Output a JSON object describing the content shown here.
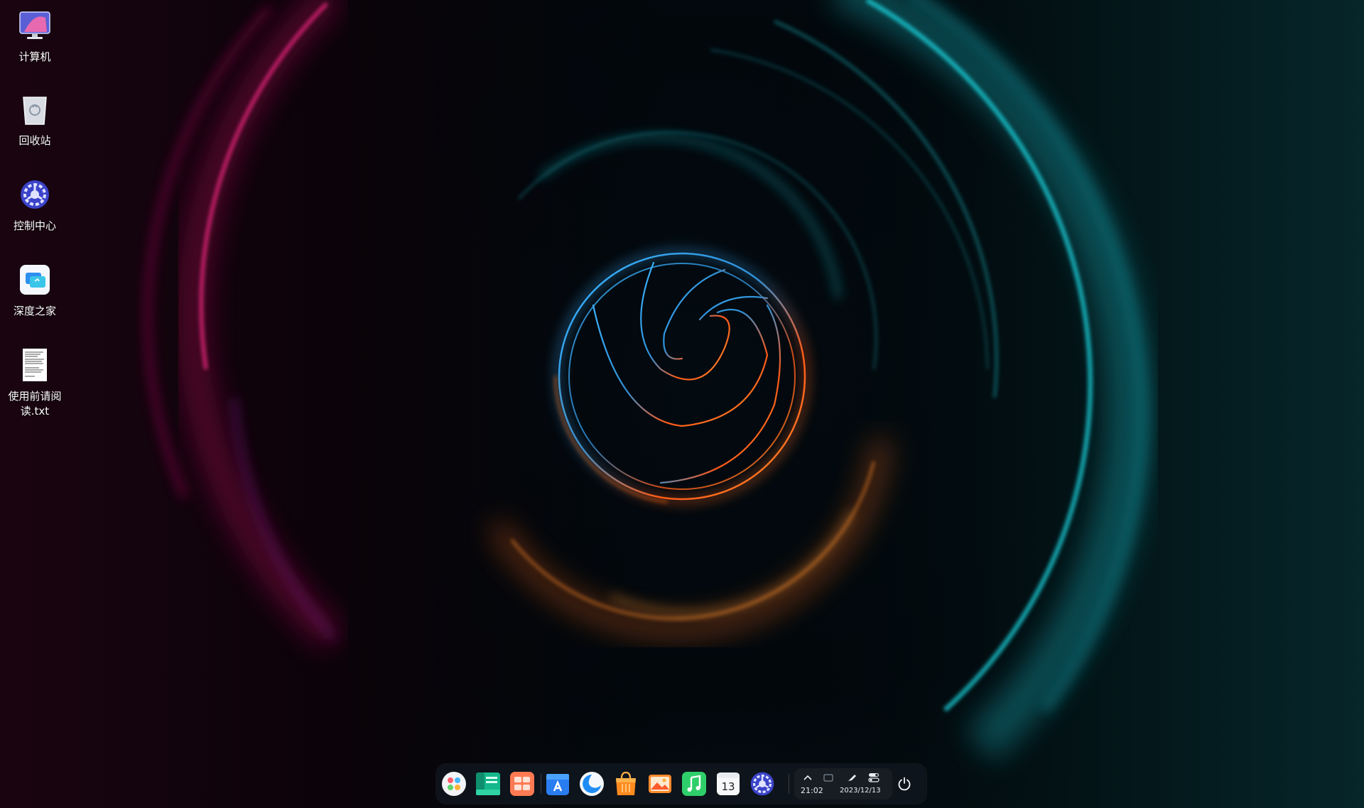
{
  "desktop": {
    "icons": [
      {
        "label": "计算机",
        "icon": "computer-icon"
      },
      {
        "label": "回收站",
        "icon": "trash-icon"
      },
      {
        "label": "控制中心",
        "icon": "control-center-icon"
      },
      {
        "label": "深度之家",
        "icon": "deepin-home-icon"
      },
      {
        "label": "使用前请阅读.txt",
        "icon": "text-file-icon"
      }
    ]
  },
  "dock": {
    "apps": [
      {
        "name": "launcher",
        "icon": "launcher-icon"
      },
      {
        "name": "file-manager",
        "icon": "file-manager-icon"
      },
      {
        "name": "multitasking",
        "icon": "multitask-view-icon"
      },
      {
        "name": "app-store",
        "icon": "app-store-icon"
      },
      {
        "name": "browser",
        "icon": "browser-icon"
      },
      {
        "name": "app-bag",
        "icon": "shopping-bag-icon"
      },
      {
        "name": "image-viewer",
        "icon": "image-viewer-icon"
      },
      {
        "name": "music",
        "icon": "music-icon"
      },
      {
        "name": "calendar",
        "icon": "calendar-icon",
        "badge": "13"
      },
      {
        "name": "control-center",
        "icon": "control-center-icon"
      }
    ],
    "tray": {
      "time": "21:02",
      "date": "2023/12/13",
      "icons": [
        "chevron-up-icon",
        "keyboard-icon",
        "pen-icon",
        "toggle-icon"
      ]
    },
    "power_icon": "power-icon"
  },
  "colors": {
    "teal": "#19d2de",
    "magenta": "#e0106e",
    "orange": "#ff6a14",
    "blue": "#3aa8e6"
  }
}
